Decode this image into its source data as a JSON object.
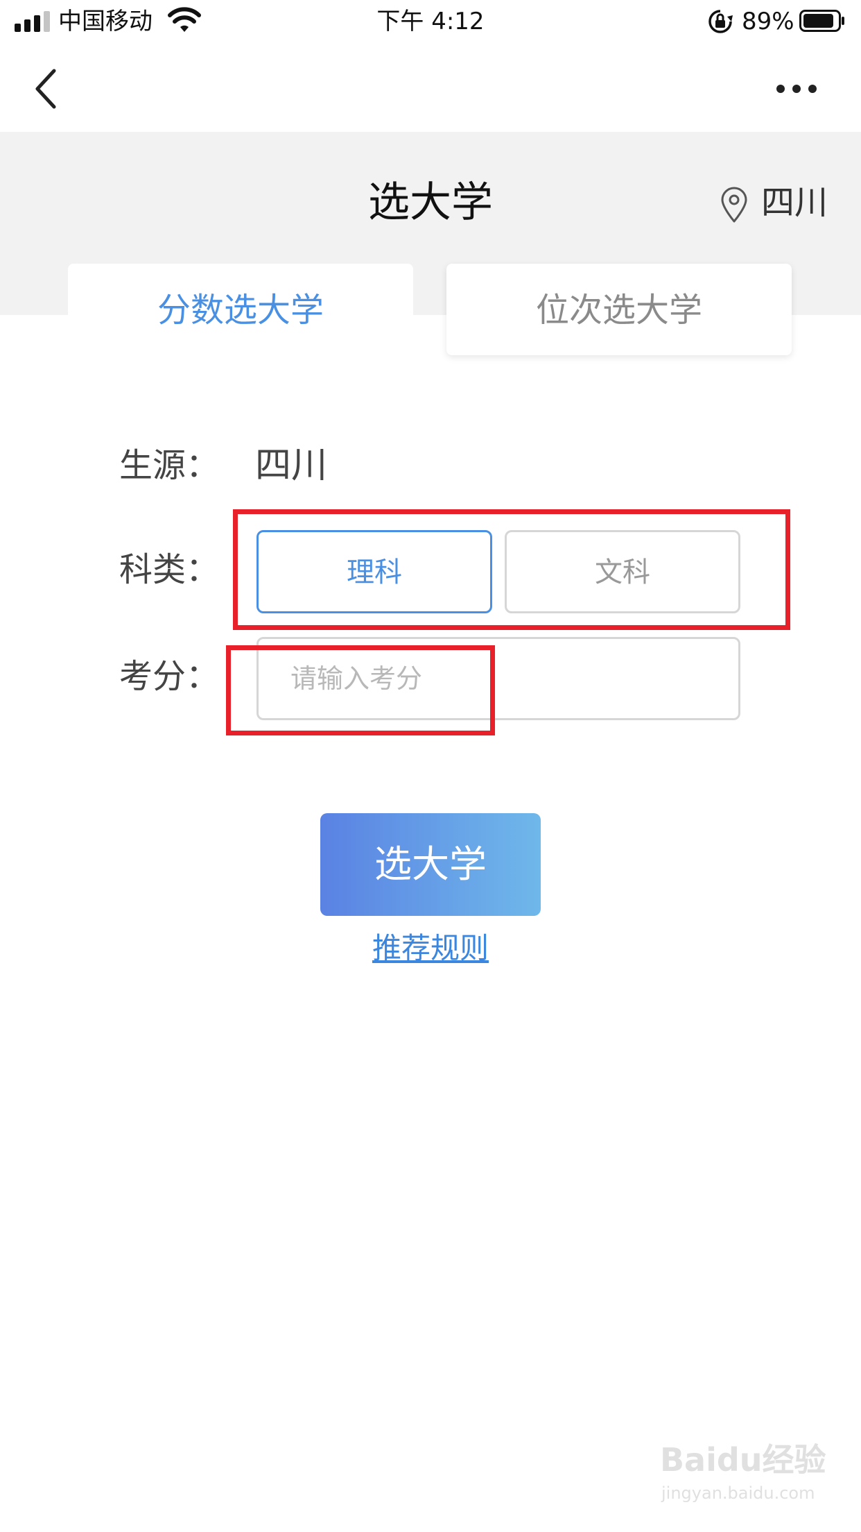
{
  "status_bar": {
    "carrier": "中国移动",
    "time": "下午 4:12",
    "battery_percent": "89%",
    "signal_bars_active": 3,
    "signal_bars_total": 4,
    "battery_level": 0.89
  },
  "nav": {
    "back_icon": "chevron-left-icon",
    "more_icon": "more-dots-icon"
  },
  "header": {
    "title": "选大学",
    "location": "四川",
    "location_icon": "map-pin-icon"
  },
  "tabs": [
    {
      "label": "分数选大学",
      "active": true
    },
    {
      "label": "位次选大学",
      "active": false
    }
  ],
  "form": {
    "source_label": "生源：",
    "source_value": "四川",
    "subject_label": "科类：",
    "subject_options": [
      {
        "label": "理科",
        "selected": true
      },
      {
        "label": "文科",
        "selected": false
      }
    ],
    "score_label": "考分：",
    "score_value": "",
    "score_placeholder": "请输入考分"
  },
  "actions": {
    "submit_label": "选大学",
    "rules_link": "推荐规则"
  },
  "watermark": {
    "brand": "Baidu经验",
    "url": "jingyan.baidu.com"
  },
  "colors": {
    "accent": "#4a90e2",
    "annotation": "#e8202a",
    "header_band": "#f2f2f2",
    "button_gradient_start": "#5a82e3",
    "button_gradient_end": "#6fb8ea"
  }
}
